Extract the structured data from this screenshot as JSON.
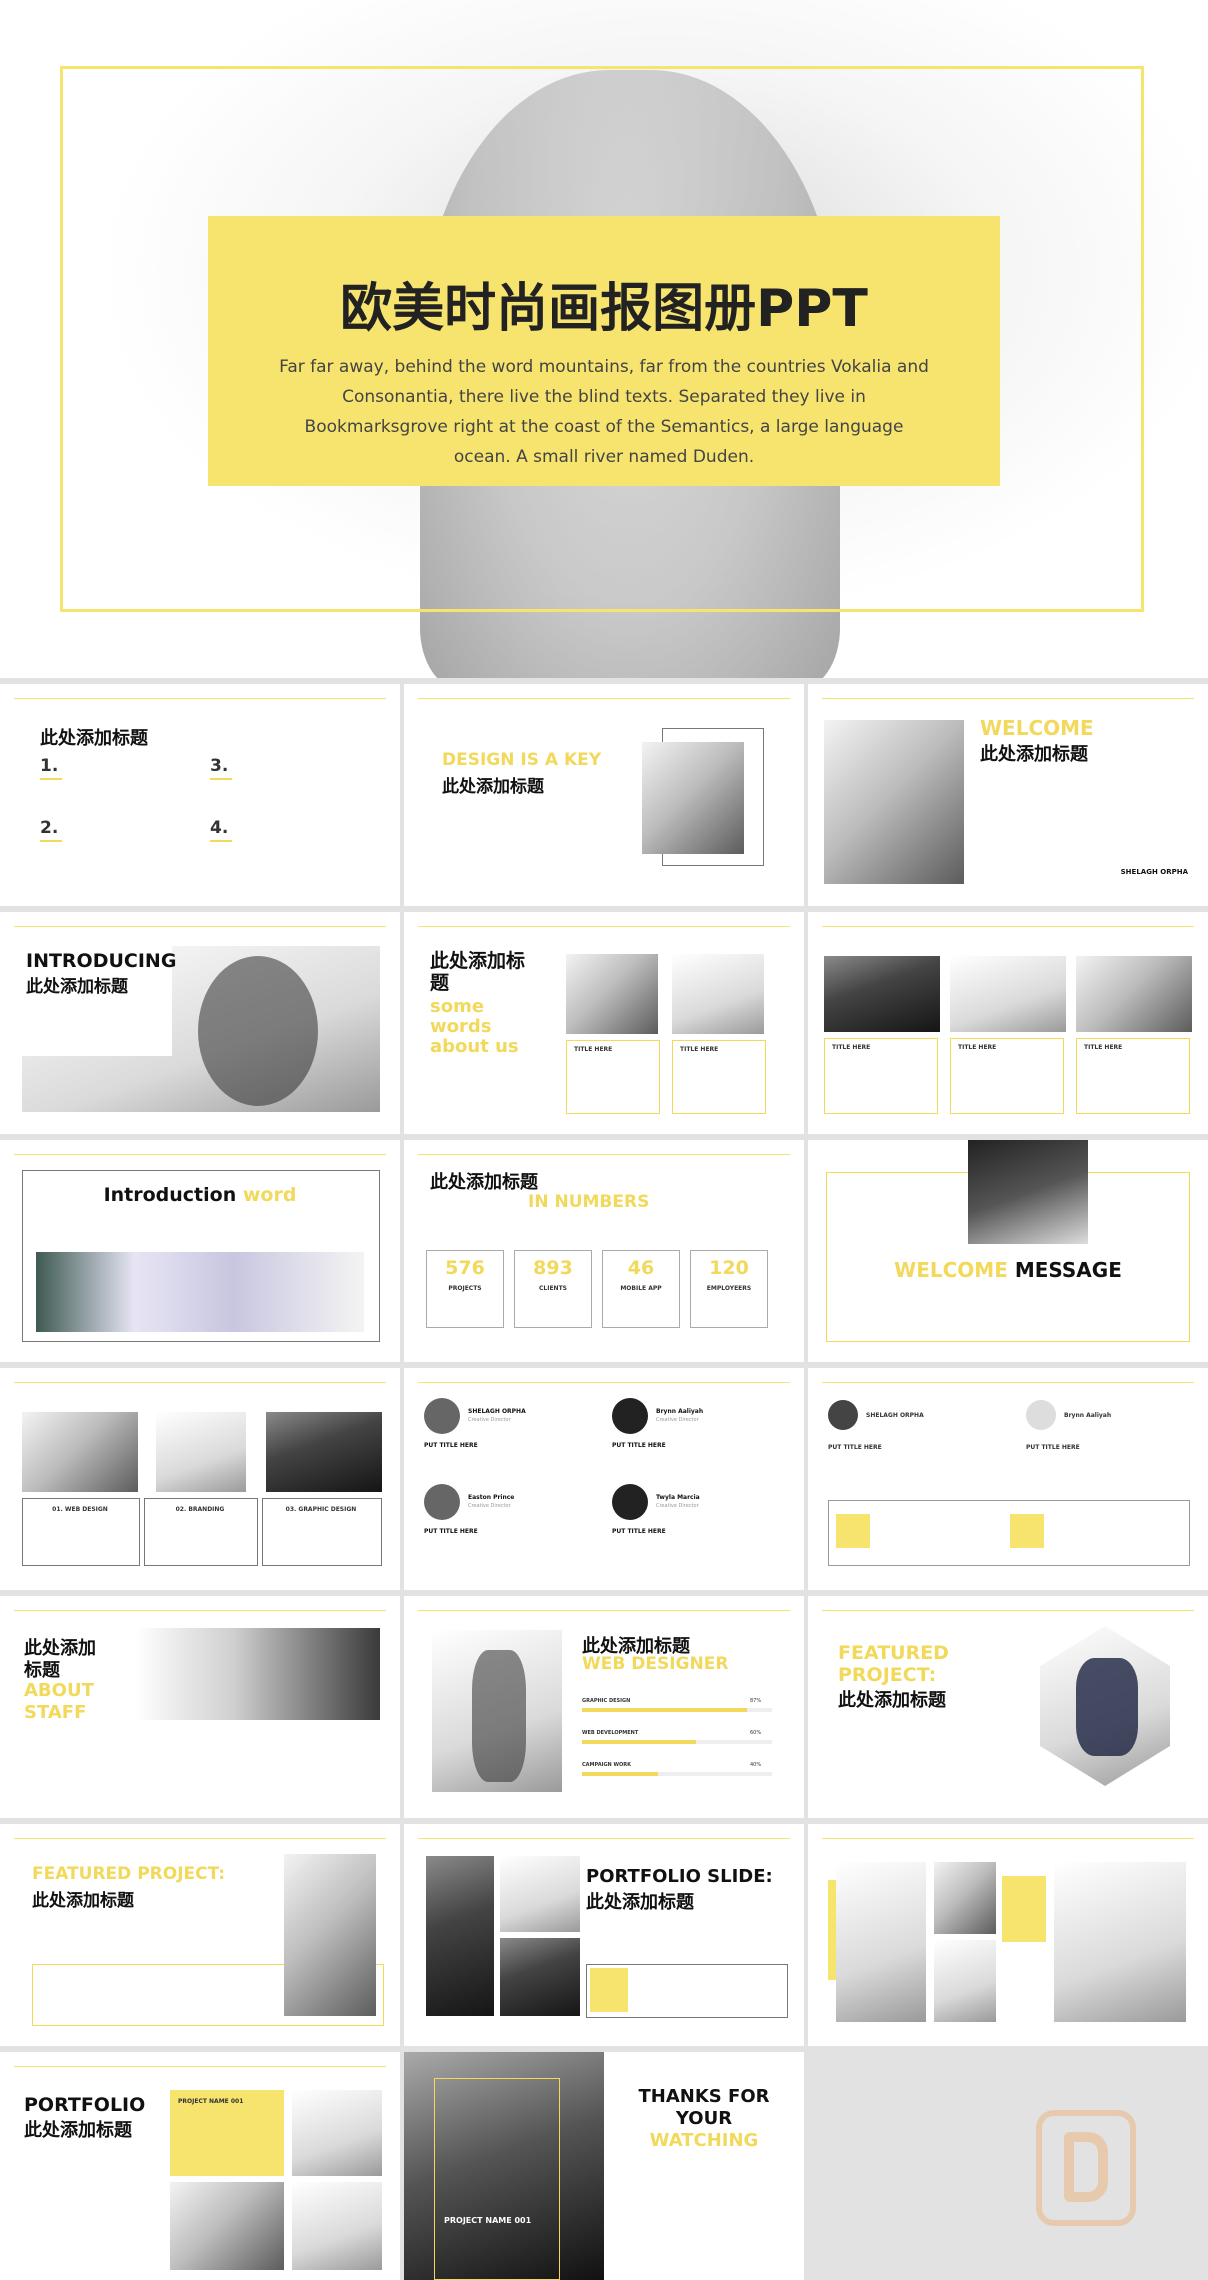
{
  "hero": {
    "title": "欧美时尚画报图册PPT",
    "body": "Far far away, behind the word mountains, far from the countries Vokalia and Consonantia, there live the blind texts. Separated they live in Bookmarksgrove right at the coast of the Semantics, a large language ocean. A small river named Duden."
  },
  "s1": {
    "title": "此处添加标题",
    "n1": "1.",
    "n2": "2.",
    "n3": "3.",
    "n4": "4."
  },
  "s2": {
    "title_en": "DESIGN IS A KEY",
    "title_cn": "此处添加标题"
  },
  "s3": {
    "title_en": "WELCOME",
    "title_cn": "此处添加标题",
    "name": "SHELAGH ORPHA"
  },
  "s4": {
    "title_en": "INTRODUCING",
    "title_cn": "此处添加标题"
  },
  "s5": {
    "title_cn": "此处添加标题",
    "l1": "some",
    "l2": "words",
    "l3": "about us",
    "c1": "TITLE HERE",
    "c2": "TITLE HERE"
  },
  "s6": {
    "c1": "TITLE HERE",
    "c2": "TITLE HERE",
    "c3": "TITLE HERE"
  },
  "s7": {
    "title_a": "Introduction",
    "title_b": "word"
  },
  "s8": {
    "title_cn": "此处添加标题",
    "title_en": "IN NUMBERS",
    "stats": [
      {
        "value": "576",
        "label": "PROJECTS"
      },
      {
        "value": "893",
        "label": "CLIENTS"
      },
      {
        "value": "46",
        "label": "MOBILE APP"
      },
      {
        "value": "120",
        "label": "EMPLOYEERS"
      }
    ]
  },
  "s9": {
    "title_a": "WELCOME",
    "title_b": "MESSAGE"
  },
  "s10": {
    "c1": "01. WEB DESIGN",
    "c2": "02. BRANDING",
    "c3": "03. GRAPHIC DESIGN"
  },
  "s11": {
    "people": [
      {
        "name": "SHELAGH ORPHA",
        "role": "Creative Director"
      },
      {
        "name": "Brynn Aaliyah",
        "role": "Creative Director"
      },
      {
        "name": "Easton Prince",
        "role": "Creative Director"
      },
      {
        "name": "Twyla Marcia",
        "role": "Creative Director"
      }
    ],
    "put_title": "PUT TITLE HERE"
  },
  "s12": {
    "p1": "SHELAGH ORPHA",
    "p2": "Brynn Aaliyah",
    "put_title": "PUT TITLE HERE"
  },
  "s13": {
    "l1": "此处添加",
    "l2": "标题",
    "l3": "ABOUT",
    "l4": "STAFF"
  },
  "s14": {
    "title_cn": "此处添加标题",
    "title_en": "WEB DESIGNER",
    "skills": [
      {
        "label": "GRAPHIC DESIGN",
        "pct": "87%",
        "value": 0.87
      },
      {
        "label": "WEB DEVELOPMENT",
        "pct": "60%",
        "value": 0.6
      },
      {
        "label": "CAMPAIGN WORK",
        "pct": "40%",
        "value": 0.4
      }
    ]
  },
  "s15": {
    "l1": "FEATURED",
    "l2": "PROJECT:",
    "l3": "此处添加标题"
  },
  "s16": {
    "l1": "FEATURED PROJECT:",
    "l2": "此处添加标题"
  },
  "s17": {
    "l1": "PORTFOLIO SLIDE:",
    "l2": "此处添加标题"
  },
  "s19": {
    "l1": "PORTFOLIO",
    "l2": "此处添加标题",
    "tag": "PROJECT NAME 001"
  },
  "s20": {
    "tag": "PROJECT NAME 001"
  },
  "s21": {
    "l1": "THANKS FOR",
    "l2": "YOUR",
    "l3": "WATCHING"
  }
}
